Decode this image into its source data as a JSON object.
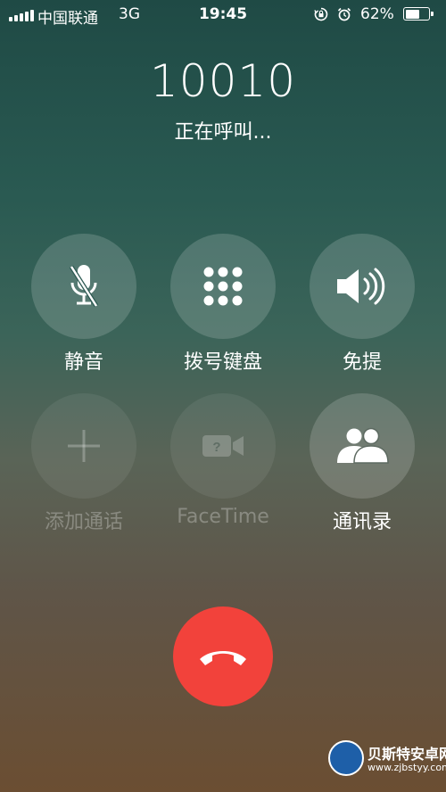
{
  "status_bar": {
    "carrier": "中国联通",
    "network": "3G",
    "time": "19:45",
    "battery_percent": "62%",
    "battery_level": 0.62,
    "icons": [
      "signal-icon",
      "orientation-lock-icon",
      "alarm-icon",
      "battery-icon"
    ]
  },
  "call": {
    "number": "10010",
    "status": "正在呼叫..."
  },
  "controls": [
    {
      "label": "静音",
      "icon": "mic-off-icon",
      "enabled": true
    },
    {
      "label": "拨号键盘",
      "icon": "keypad-icon",
      "enabled": true
    },
    {
      "label": "免提",
      "icon": "speaker-icon",
      "enabled": true
    },
    {
      "label": "添加通话",
      "icon": "plus-icon",
      "enabled": false
    },
    {
      "label": "FaceTime",
      "icon": "video-camera-icon",
      "enabled": false
    },
    {
      "label": "通讯录",
      "icon": "contacts-icon",
      "enabled": true
    }
  ],
  "end_call": {
    "icon": "end-call-icon",
    "color": "#f2423b"
  },
  "watermark": {
    "name": "贝斯特安卓网",
    "url": "www.zjbstyy.com"
  }
}
